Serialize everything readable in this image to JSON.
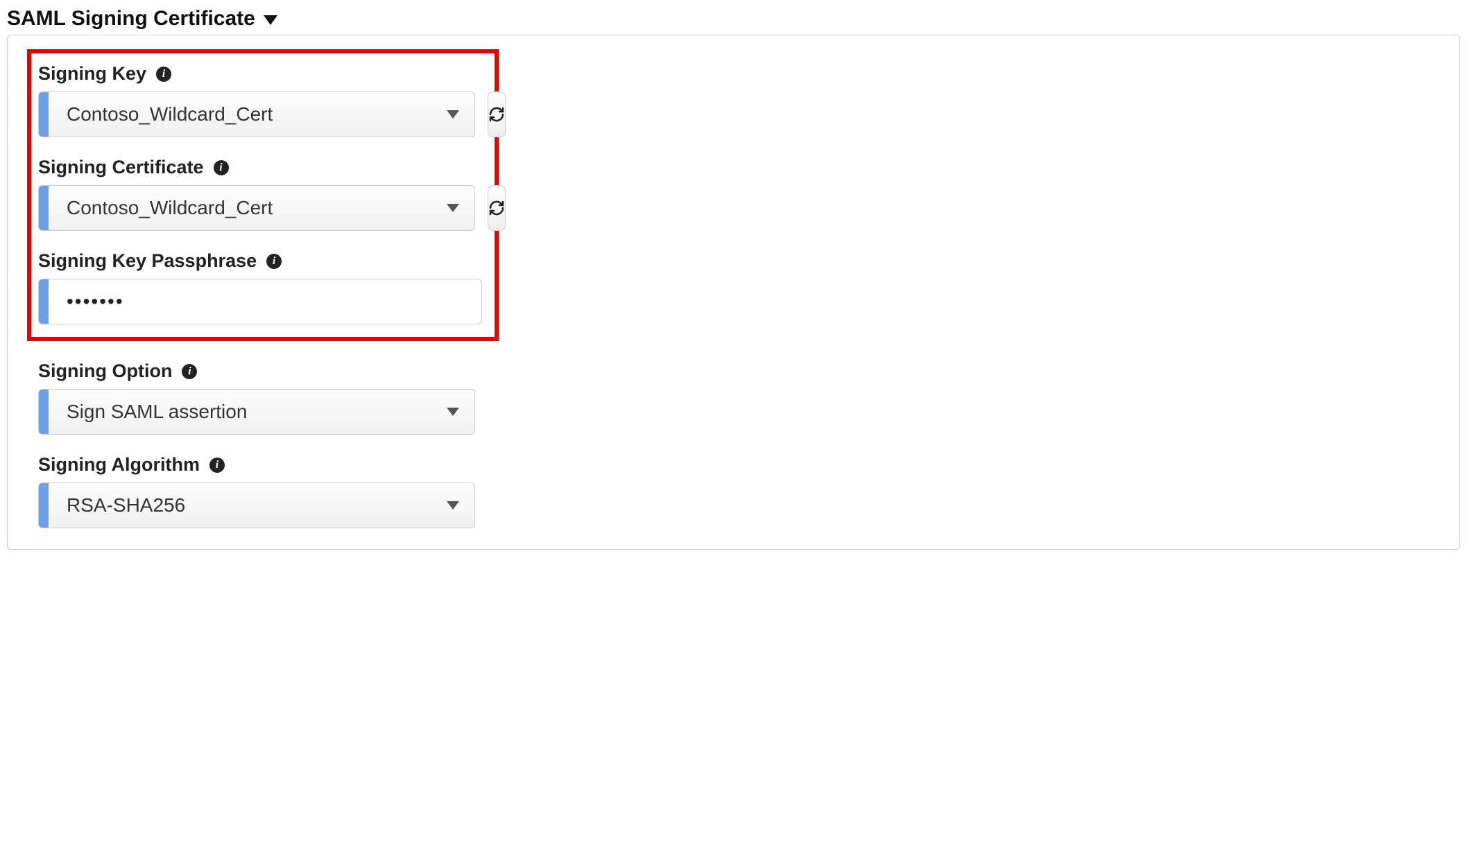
{
  "section": {
    "title": "SAML Signing Certificate"
  },
  "fields": {
    "signing_key": {
      "label": "Signing Key",
      "value": "Contoso_Wildcard_Cert"
    },
    "signing_certificate": {
      "label": "Signing Certificate",
      "value": "Contoso_Wildcard_Cert"
    },
    "signing_key_passphrase": {
      "label": "Signing Key Passphrase",
      "value": "•••••••"
    },
    "signing_option": {
      "label": "Signing Option",
      "value": "Sign SAML assertion"
    },
    "signing_algorithm": {
      "label": "Signing Algorithm",
      "value": "RSA-SHA256"
    }
  }
}
